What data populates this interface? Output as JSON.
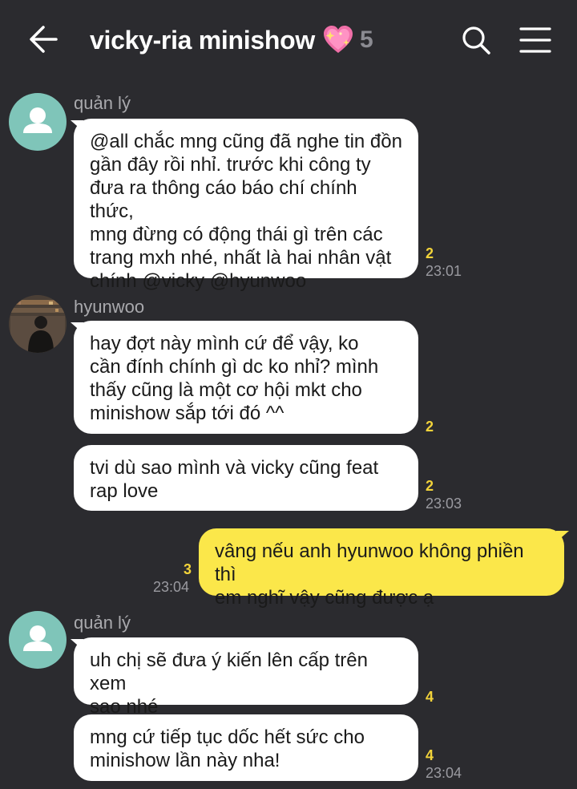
{
  "header": {
    "title": "vicky-ria minishow",
    "emoji": "sparkling-heart-emoji",
    "member_count": "5"
  },
  "colors": {
    "background": "#2b2b2f",
    "incoming_bubble": "#ffffff",
    "outgoing_bubble": "#fbe74a",
    "unread_count": "#f2d33a",
    "avatar_default": "#7fc5b9"
  },
  "messages": [
    {
      "sender": "quản lý",
      "text": "@all chắc mng cũng đã nghe tin đồn\ngần đây rồi nhỉ. trước khi công ty\nđưa ra thông cáo báo chí chính thức,\nmng đừng có động thái gì trên các\ntrang mxh nhé, nhất là hai nhân vật\nchính @vicky @hyunwoo",
      "unread": "2",
      "time": "23:01"
    },
    {
      "sender": "hyunwoo",
      "text": "hay đợt này mình cứ để vậy, ko\ncần đính chính gì dc ko nhỉ? mình\nthấy cũng là một cơ hội mkt cho\nminishow sắp tới đó ^^",
      "unread": "2"
    },
    {
      "text": "tvi dù sao mình và vicky cũng feat\nrap love",
      "unread": "2",
      "time": "23:03"
    },
    {
      "text": "vâng nếu anh hyunwoo không phiền thì\nem nghĩ vậy cũng được ạ",
      "unread": "3",
      "time": "23:04"
    },
    {
      "sender": "quản lý",
      "text": "uh chị sẽ đưa ý kiến lên cấp trên xem\nsao nhé",
      "unread": "4"
    },
    {
      "text": "mng cứ tiếp tục dốc hết sức cho\nminishow lần này nha!",
      "unread": "4",
      "time": "23:04"
    }
  ]
}
